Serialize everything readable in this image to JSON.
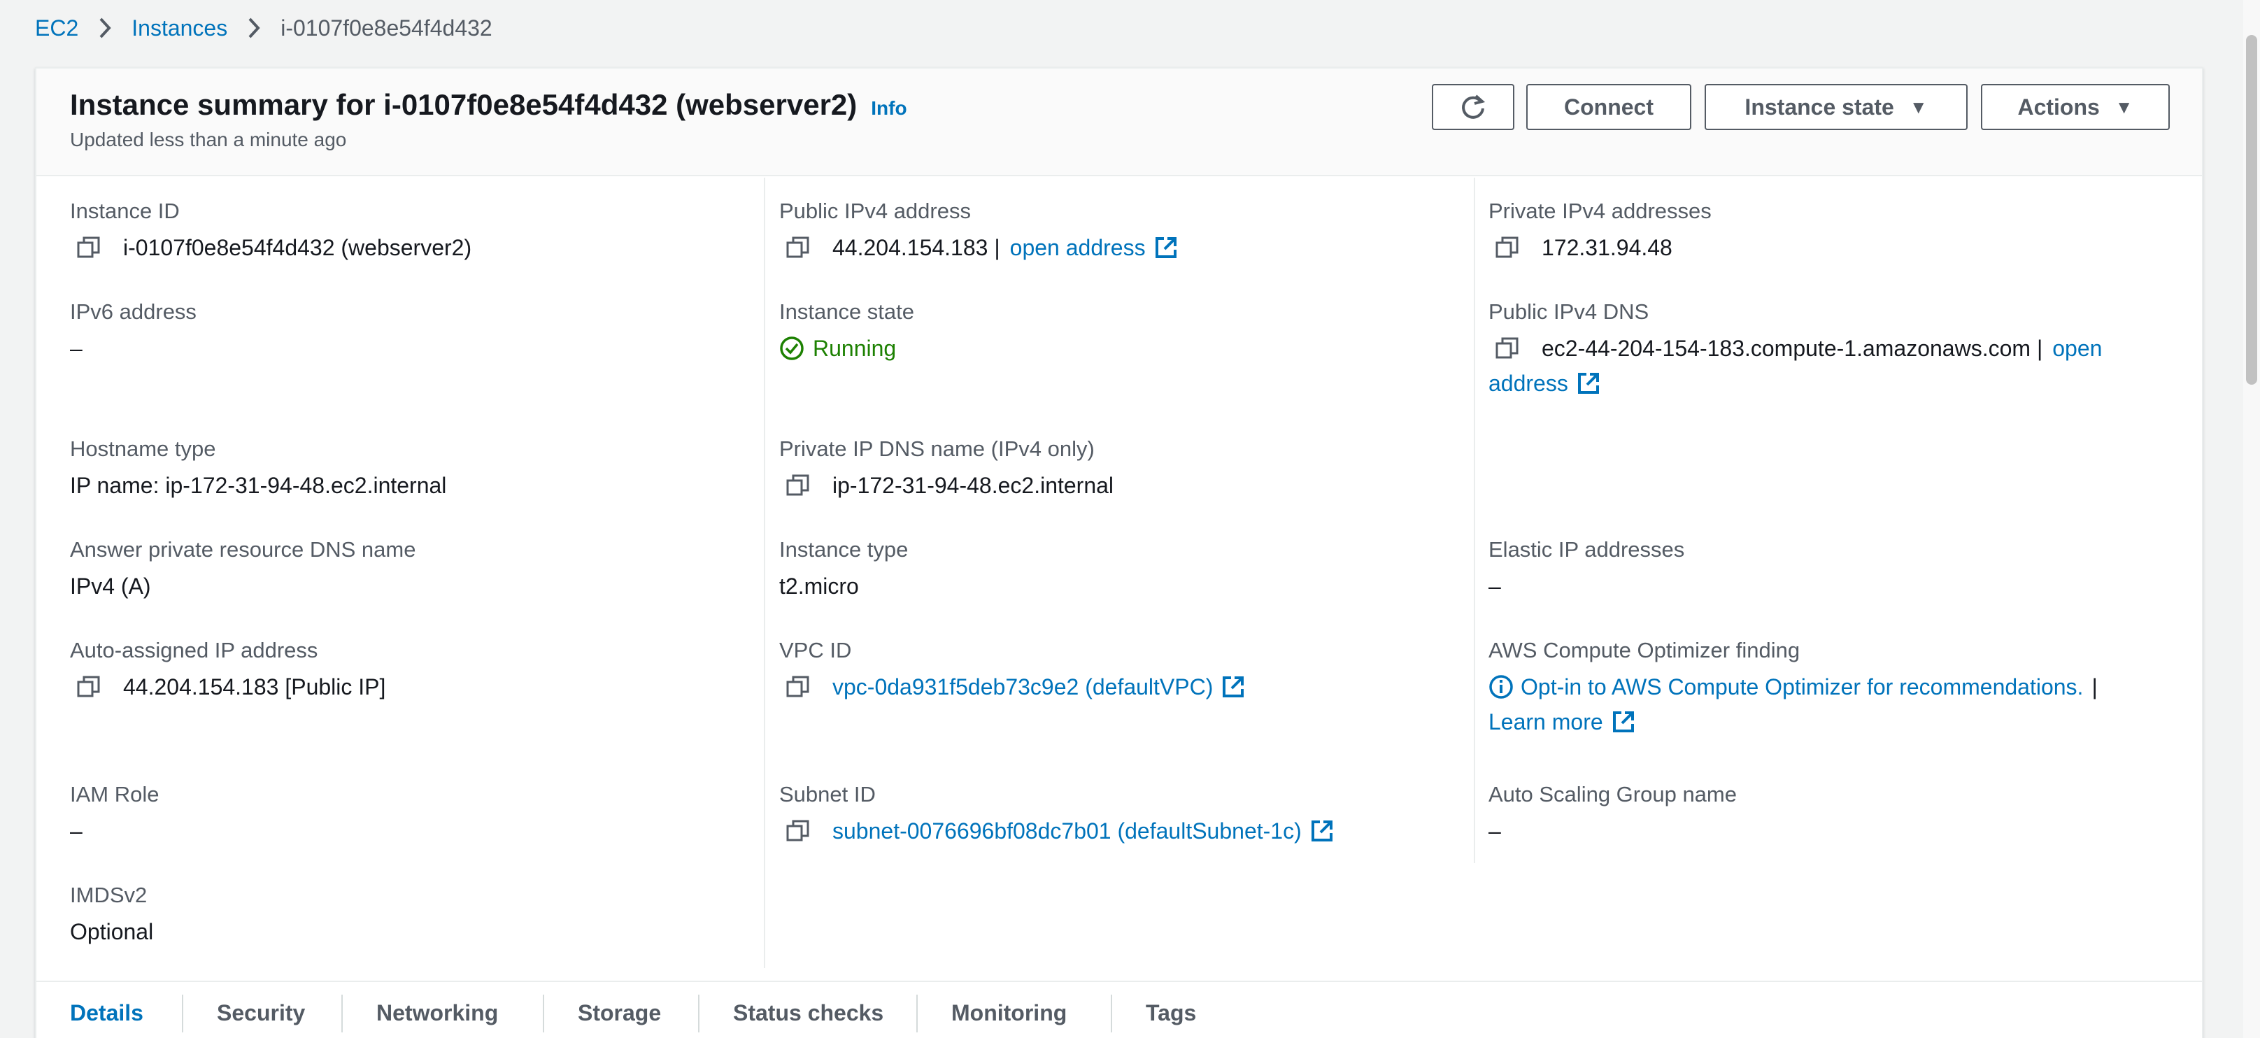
{
  "breadcrumb": {
    "root": "EC2",
    "instances": "Instances",
    "current": "i-0107f0e8e54f4d432"
  },
  "header": {
    "title": "Instance summary for i-0107f0e8e54f4d432 (webserver2)",
    "info": "Info",
    "updated": "Updated less than a minute ago",
    "buttons": {
      "connect": "Connect",
      "instance_state": "Instance state",
      "actions": "Actions"
    }
  },
  "fields": {
    "instance_id": {
      "label": "Instance ID",
      "value": "i-0107f0e8e54f4d432 (webserver2)"
    },
    "public_ipv4": {
      "label": "Public IPv4 address",
      "value": "44.204.154.183 |",
      "link": "open address"
    },
    "private_ipv4": {
      "label": "Private IPv4 addresses",
      "value": "172.31.94.48"
    },
    "ipv6": {
      "label": "IPv6 address",
      "value": "–"
    },
    "instance_state": {
      "label": "Instance state",
      "value": "Running"
    },
    "public_dns": {
      "label": "Public IPv4 DNS",
      "value": "ec2-44-204-154-183.compute-1.amazonaws.com |",
      "link_part1": "open",
      "link_part2": "address"
    },
    "hostname_type": {
      "label": "Hostname type",
      "value": "IP name: ip-172-31-94-48.ec2.internal"
    },
    "private_dns": {
      "label": "Private IP DNS name (IPv4 only)",
      "value": "ip-172-31-94-48.ec2.internal"
    },
    "answer_dns": {
      "label": "Answer private resource DNS name",
      "value": "IPv4 (A)"
    },
    "instance_type": {
      "label": "Instance type",
      "value": "t2.micro"
    },
    "elastic_ip": {
      "label": "Elastic IP addresses",
      "value": "–"
    },
    "auto_ip": {
      "label": "Auto-assigned IP address",
      "value": "44.204.154.183 [Public IP]"
    },
    "vpc_id": {
      "label": "VPC ID",
      "value": "vpc-0da931f5deb73c9e2 (defaultVPC)"
    },
    "optimizer": {
      "label": "AWS Compute Optimizer finding",
      "value": "Opt-in to AWS Compute Optimizer for recommendations.",
      "sep": "|",
      "learn_more": "Learn more"
    },
    "iam_role": {
      "label": "IAM Role",
      "value": "–"
    },
    "subnet_id": {
      "label": "Subnet ID",
      "value": "subnet-0076696bf08dc7b01 (defaultSubnet-1c)"
    },
    "asg_name": {
      "label": "Auto Scaling Group name",
      "value": "–"
    },
    "imdsv2": {
      "label": "IMDSv2",
      "value": "Optional"
    }
  },
  "tabs": [
    "Details",
    "Security",
    "Networking",
    "Storage",
    "Status checks",
    "Monitoring",
    "Tags"
  ],
  "active_tab": "Details",
  "colors": {
    "link": "#0073bb",
    "running": "#1d8102",
    "text": "#16191f",
    "muted": "#545b64"
  }
}
